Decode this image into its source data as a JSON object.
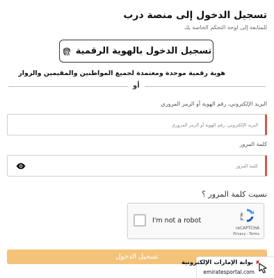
{
  "header": {
    "title": "تسجيل الدخول إلى منصة درب",
    "subtitle": "للمتابعة إلى لوحة التحكم الخاصة بك"
  },
  "uaepass": {
    "button_label": "تسجيل الدخول بالهوية الرقمية",
    "description": "هوية رقمية موحدة ومعتمدة لجميع المواطنين والمقيمين والزوار"
  },
  "divider": {
    "or_label": "أو"
  },
  "email_field": {
    "label": "البريد الإلكتروني، رقم الهوية أو الرمز المروري",
    "placeholder": "البريد الإلكتروني، رقم الهوية أو الرمز المروري"
  },
  "password_field": {
    "label": "كلمة المرور",
    "placeholder": "كلمة المرور"
  },
  "forgot_password": "نسيت كلمة المرور ؟",
  "recaptcha": {
    "checkbox_label": "I'm not a robot",
    "brand": "reCAPTCHA",
    "links": "Privacy - Terms"
  },
  "submit": {
    "label": "تسجيل الدخول"
  },
  "watermark": {
    "arabic": "بوابة الإمارات الإلكترونية",
    "latin": "emiratesportal.com"
  },
  "colors": {
    "submit_bg": "#f4c37a",
    "invalid_border": "#d9534f",
    "portal_accent": "#d62828"
  },
  "icons": {
    "uaepass": "fingerprint-icon",
    "password_toggle": "eye-icon",
    "recaptcha": "recaptcha-logo-icon",
    "portal": "cursor-click-icon"
  }
}
